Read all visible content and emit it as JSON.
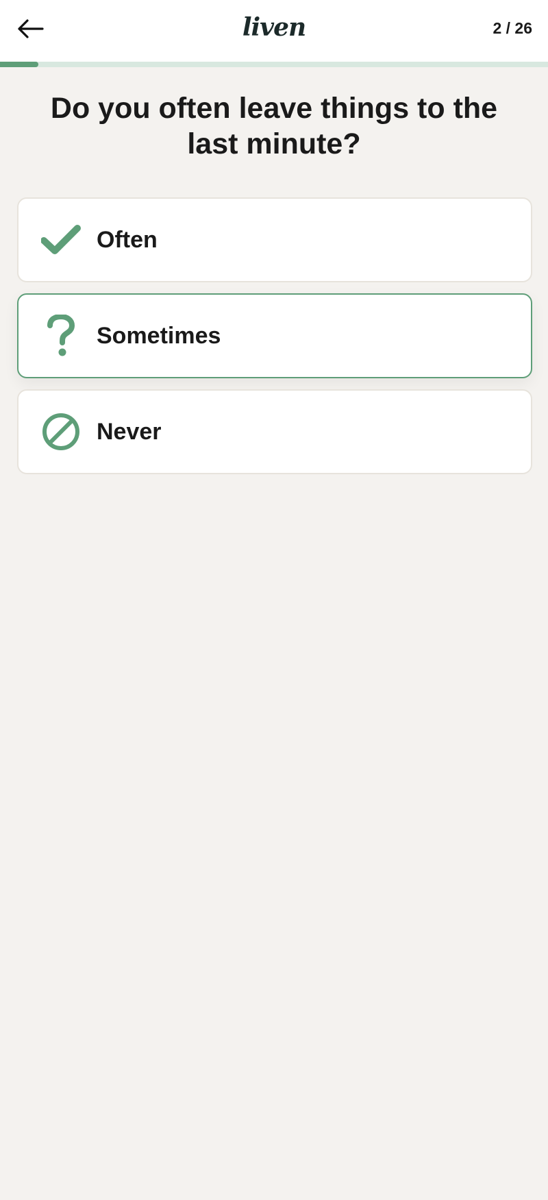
{
  "header": {
    "logo_text": "liven",
    "counter": "2 / 26"
  },
  "progress": {
    "value": 0.07
  },
  "question": {
    "text": "Do you often leave things to the last minute?"
  },
  "options": [
    {
      "label": "Often",
      "icon": "checkmark-icon",
      "selected": false
    },
    {
      "label": "Sometimes",
      "icon": "question-mark-icon",
      "selected": true
    },
    {
      "label": "Never",
      "icon": "prohibited-icon",
      "selected": false
    }
  ],
  "colors": {
    "accent": "#5e9e78",
    "progress_track": "#d8e8df",
    "background": "#f4f2ef",
    "card": "#ffffff",
    "text": "#1a1a1a"
  }
}
